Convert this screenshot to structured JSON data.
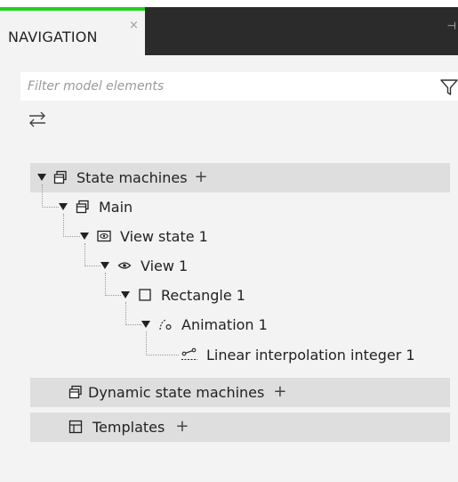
{
  "panel": {
    "tab_label": "NAVIGATION",
    "close_glyph": "×",
    "pin_glyph": "⊣"
  },
  "filter": {
    "placeholder": "Filter model elements",
    "value": ""
  },
  "tree": {
    "state_machines": "State machines",
    "main": "Main",
    "view_state": "View state 1",
    "view": "View 1",
    "rectangle": "Rectangle 1",
    "animation": "Animation 1",
    "interpolation": "Linear interpolation integer 1",
    "dynamic_state_machines": "Dynamic state machines",
    "templates": "Templates"
  },
  "glyphs": {
    "plus": "+"
  },
  "icons": [
    "state-machine-icon",
    "view-state-icon",
    "eye-icon",
    "rectangle-icon",
    "animation-icon",
    "interpolation-icon",
    "templates-icon",
    "filter-icon",
    "swap-icon"
  ],
  "colors": {
    "accent": "#1fd11f",
    "dark_bar": "#2b2b2b",
    "panel_bg": "#f3f3f3",
    "section_bg": "#dedede"
  }
}
